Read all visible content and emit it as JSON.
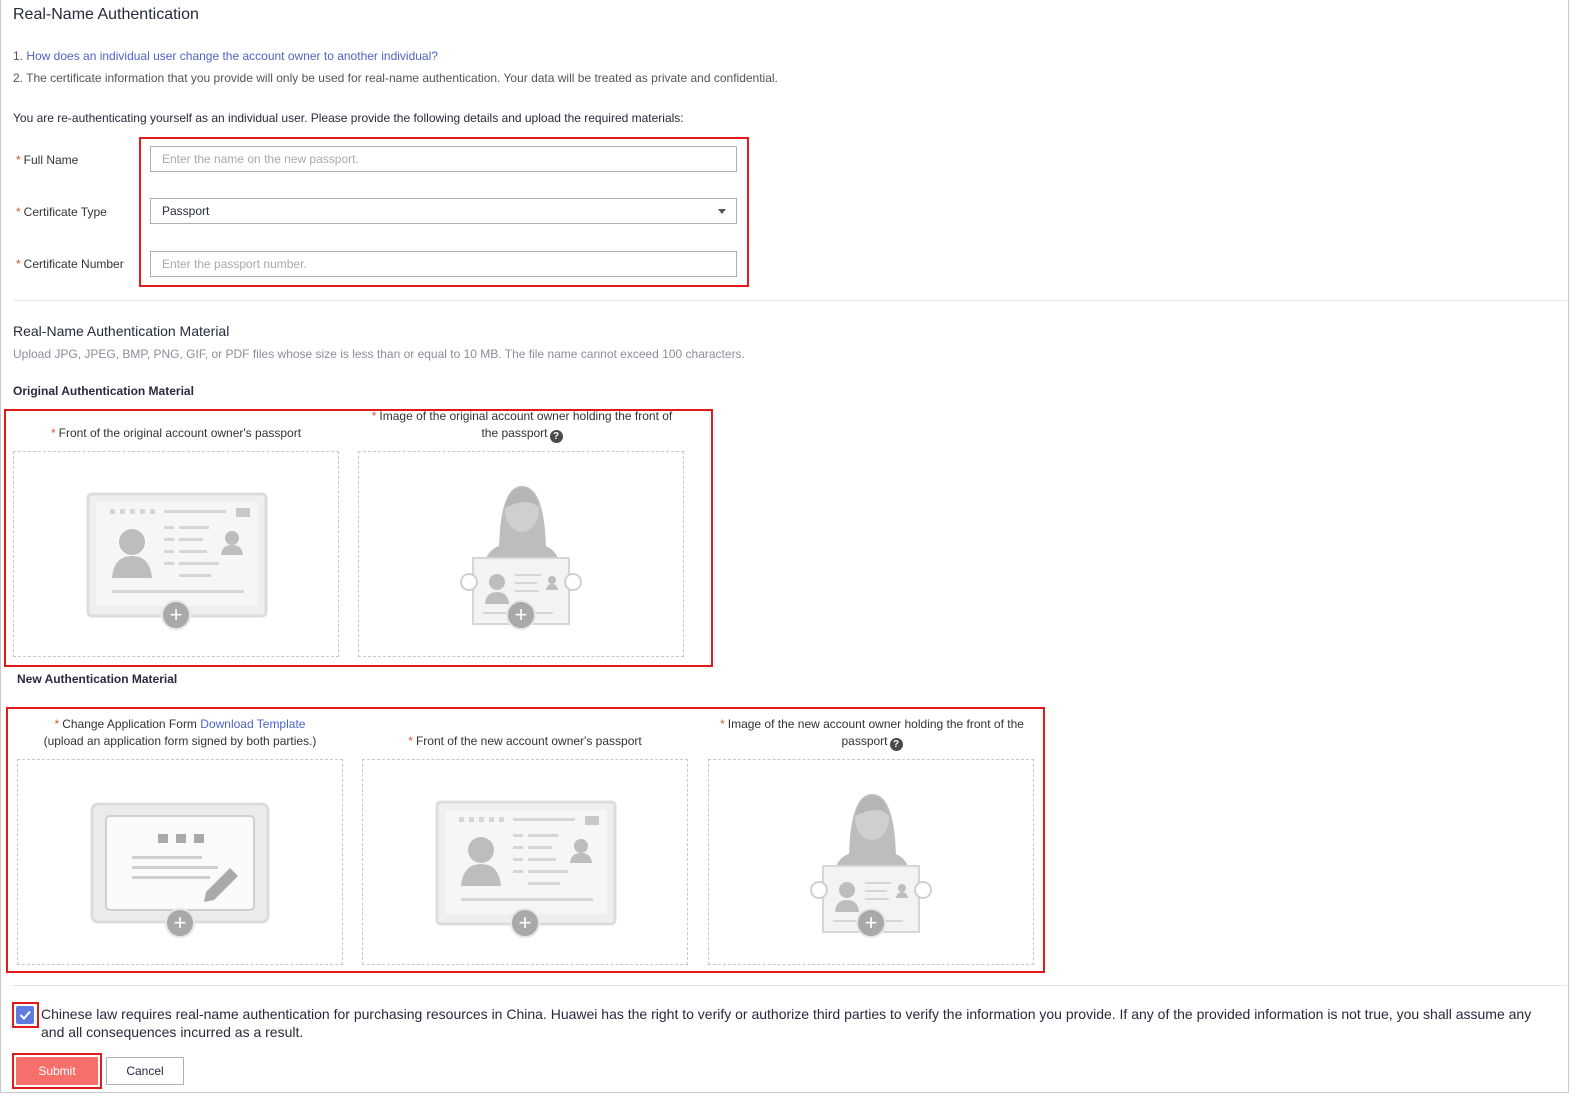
{
  "page": {
    "title": "Real-Name Authentication",
    "note1_prefix": "1. ",
    "note1_link": "How does an individual user change the account owner to another individual?",
    "note2": "2. The certificate information that you provide will only be used for real-name authentication. Your data will be treated as private and confidential.",
    "intro": "You are re-authenticating yourself as an individual user. Please provide the following details and upload the required materials:"
  },
  "form": {
    "required_mark": "*",
    "full_name_label": "Full Name",
    "full_name_placeholder": "Enter the name on the new passport.",
    "cert_type_label": "Certificate Type",
    "cert_type_value": "Passport",
    "cert_number_label": "Certificate Number",
    "cert_number_placeholder": "Enter the passport number."
  },
  "material": {
    "heading": "Real-Name Authentication Material",
    "hint": "Upload JPG, JPEG, BMP, PNG, GIF, or PDF files whose size is less than or equal to 10 MB. The file name cannot exceed 100 characters.",
    "original_heading": "Original Authentication Material",
    "original_front": "Front of the original account owner's passport",
    "original_holding": "Image of the original account owner holding the front of the passport",
    "new_heading": "New Authentication Material",
    "change_form": "Change Application Form",
    "download_template": "Download Template",
    "change_form_note": "(upload an application form signed by both parties.)",
    "new_front": "Front of the new account owner's passport",
    "new_holding": "Image of the new account owner holding the front of the passport",
    "help_glyph": "?",
    "plus_glyph": "+"
  },
  "footer": {
    "agreement_checked": true,
    "agreement": "Chinese law requires real-name authentication for purchasing resources in China. Huawei has the right to verify or authorize third parties to verify the information you provide. If any of the provided information is not true, you shall assume any and all consequences incurred as a result.",
    "submit": "Submit",
    "cancel": "Cancel"
  },
  "colors": {
    "accent": "#5e7ce0",
    "link": "#4d64c8",
    "required": "#e0533d",
    "submit": "#f66f6a",
    "highlight_box": "#e31a1c"
  }
}
